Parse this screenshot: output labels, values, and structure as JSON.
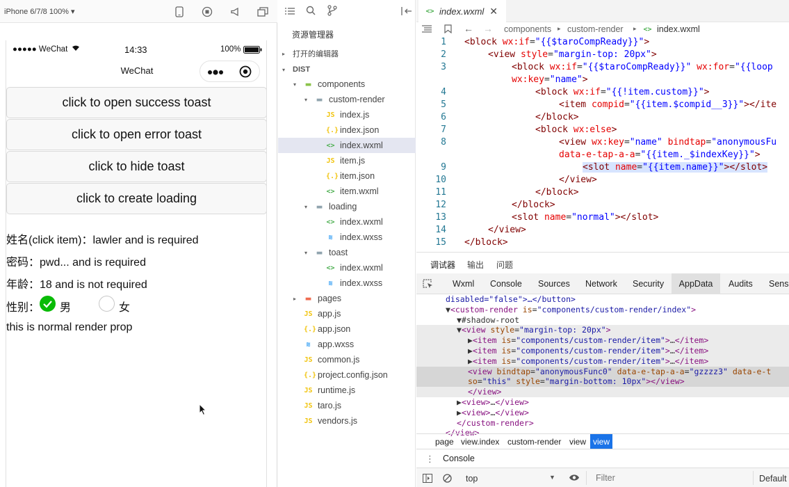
{
  "simulator": {
    "device": "iPhone 6/7/8 100% ▾",
    "status": {
      "carrier": "●●●●● WeChat",
      "time": "14:33",
      "battery": "100%"
    },
    "nav_title": "WeChat",
    "buttons": [
      "click to open success toast",
      "click to open error toast",
      "click to hide toast",
      "click to create loading"
    ],
    "lines": {
      "name": "姓名(click item)：lawler and is required",
      "password": "密码：pwd... and is required",
      "age": "年龄：18 and is not required",
      "gender_label": "性别：",
      "male": "男",
      "female": "女",
      "normal": "this is normal render prop"
    }
  },
  "explorer": {
    "title": "资源管理器",
    "open_editors": "打开的编辑器",
    "root": "DIST",
    "items": [
      {
        "label": "components",
        "icon": "folder-icon",
        "color": "#8bc34a",
        "depth": 1,
        "caret": "▾"
      },
      {
        "label": "custom-render",
        "icon": "folder-icon",
        "color": "#90a4ae",
        "depth": 2,
        "caret": "▾"
      },
      {
        "label": "index.js",
        "icon": "js-file-icon",
        "color": "#f1c40f",
        "depth": 3,
        "caret": ""
      },
      {
        "label": "index.json",
        "icon": "json-file-icon",
        "color": "#f1c40f",
        "depth": 3,
        "caret": ""
      },
      {
        "label": "index.wxml",
        "icon": "wxml-file-icon",
        "color": "#4caf50",
        "depth": 3,
        "caret": "",
        "selected": true
      },
      {
        "label": "item.js",
        "icon": "js-file-icon",
        "color": "#f1c40f",
        "depth": 3,
        "caret": ""
      },
      {
        "label": "item.json",
        "icon": "json-file-icon",
        "color": "#f1c40f",
        "depth": 3,
        "caret": ""
      },
      {
        "label": "item.wxml",
        "icon": "wxml-file-icon",
        "color": "#4caf50",
        "depth": 3,
        "caret": ""
      },
      {
        "label": "loading",
        "icon": "folder-icon",
        "color": "#90a4ae",
        "depth": 2,
        "caret": "▾"
      },
      {
        "label": "index.wxml",
        "icon": "wxml-file-icon",
        "color": "#4caf50",
        "depth": 3,
        "caret": ""
      },
      {
        "label": "index.wxss",
        "icon": "wxss-file-icon",
        "color": "#2196f3",
        "depth": 3,
        "caret": ""
      },
      {
        "label": "toast",
        "icon": "folder-icon",
        "color": "#90a4ae",
        "depth": 2,
        "caret": "▾"
      },
      {
        "label": "index.wxml",
        "icon": "wxml-file-icon",
        "color": "#4caf50",
        "depth": 3,
        "caret": ""
      },
      {
        "label": "index.wxss",
        "icon": "wxss-file-icon",
        "color": "#2196f3",
        "depth": 3,
        "caret": ""
      },
      {
        "label": "pages",
        "icon": "folder-icon",
        "color": "#ef6c50",
        "depth": 1,
        "caret": "▸"
      },
      {
        "label": "app.js",
        "icon": "js-file-icon",
        "color": "#f1c40f",
        "depth": 1,
        "caret": ""
      },
      {
        "label": "app.json",
        "icon": "json-file-icon",
        "color": "#f1c40f",
        "depth": 1,
        "caret": ""
      },
      {
        "label": "app.wxss",
        "icon": "wxss-file-icon",
        "color": "#2196f3",
        "depth": 1,
        "caret": ""
      },
      {
        "label": "common.js",
        "icon": "js-file-icon",
        "color": "#f1c40f",
        "depth": 1,
        "caret": ""
      },
      {
        "label": "project.config.json",
        "icon": "json-file-icon",
        "color": "#f1c40f",
        "depth": 1,
        "caret": ""
      },
      {
        "label": "runtime.js",
        "icon": "js-file-icon",
        "color": "#f1c40f",
        "depth": 1,
        "caret": ""
      },
      {
        "label": "taro.js",
        "icon": "js-file-icon",
        "color": "#f1c40f",
        "depth": 1,
        "caret": ""
      },
      {
        "label": "vendors.js",
        "icon": "js-file-icon",
        "color": "#f1c40f",
        "depth": 1,
        "caret": ""
      }
    ]
  },
  "editor": {
    "tab": "index.wxml",
    "breadcrumb": [
      "components",
      "custom-render",
      "index.wxml"
    ],
    "lines": [
      {
        "n": "1",
        "indent": 0,
        "tokens": [
          [
            "tg",
            "<block "
          ],
          [
            "at",
            "wx:if"
          ],
          [
            "pl",
            "="
          ],
          [
            "st",
            "\"{{$taroCompReady}}\""
          ],
          [
            "tg",
            ">"
          ]
        ]
      },
      {
        "n": "2",
        "indent": 1,
        "tokens": [
          [
            "tg",
            "<view "
          ],
          [
            "at",
            "style"
          ],
          [
            "pl",
            "="
          ],
          [
            "st",
            "\"margin-top: 20px\""
          ],
          [
            "tg",
            ">"
          ]
        ]
      },
      {
        "n": "3",
        "indent": 2,
        "tokens": [
          [
            "tg",
            "<block "
          ],
          [
            "at",
            "wx:if"
          ],
          [
            "pl",
            "="
          ],
          [
            "st",
            "\"{{$taroCompReady}}\""
          ],
          [
            "pl",
            " "
          ],
          [
            "at",
            "wx:for"
          ],
          [
            "pl",
            "="
          ],
          [
            "st",
            "\"{{loop"
          ]
        ]
      },
      {
        "n": "",
        "indent": 2,
        "tokens": [
          [
            "at",
            "wx:key"
          ],
          [
            "pl",
            "="
          ],
          [
            "st",
            "\"name\""
          ],
          [
            "tg",
            ">"
          ]
        ]
      },
      {
        "n": "4",
        "indent": 3,
        "tokens": [
          [
            "tg",
            "<block "
          ],
          [
            "at",
            "wx:if"
          ],
          [
            "pl",
            "="
          ],
          [
            "st",
            "\"{{!item.custom}}\""
          ],
          [
            "tg",
            ">"
          ]
        ]
      },
      {
        "n": "5",
        "indent": 4,
        "tokens": [
          [
            "tg",
            "<item "
          ],
          [
            "at",
            "compid"
          ],
          [
            "pl",
            "="
          ],
          [
            "st",
            "\"{{item.$compid__3}}\""
          ],
          [
            "tg",
            "></ite"
          ]
        ]
      },
      {
        "n": "6",
        "indent": 3,
        "tokens": [
          [
            "tg",
            "</block>"
          ]
        ]
      },
      {
        "n": "7",
        "indent": 3,
        "tokens": [
          [
            "tg",
            "<block "
          ],
          [
            "at",
            "wx:else"
          ],
          [
            "tg",
            ">"
          ]
        ]
      },
      {
        "n": "8",
        "indent": 4,
        "tokens": [
          [
            "tg",
            "<view "
          ],
          [
            "at",
            "wx:key"
          ],
          [
            "pl",
            "="
          ],
          [
            "st",
            "\"name\""
          ],
          [
            "pl",
            " "
          ],
          [
            "at",
            "bindtap"
          ],
          [
            "pl",
            "="
          ],
          [
            "st",
            "\"anonymousFu"
          ]
        ]
      },
      {
        "n": "",
        "indent": 4,
        "tokens": [
          [
            "at",
            "data-e-tap-a-a"
          ],
          [
            "pl",
            "="
          ],
          [
            "st",
            "\"{{item._$indexKey}}\""
          ],
          [
            "tg",
            ">"
          ]
        ]
      },
      {
        "n": "9",
        "indent": 5,
        "hl": true,
        "tokens": [
          [
            "tg",
            "<slot "
          ],
          [
            "at",
            "name"
          ],
          [
            "pl",
            "="
          ],
          [
            "st",
            "\"{{item.name}}\""
          ],
          [
            "tg",
            "></slot>"
          ]
        ]
      },
      {
        "n": "10",
        "indent": 4,
        "tokens": [
          [
            "tg",
            "</view>"
          ]
        ]
      },
      {
        "n": "11",
        "indent": 3,
        "tokens": [
          [
            "tg",
            "</block>"
          ]
        ]
      },
      {
        "n": "12",
        "indent": 2,
        "tokens": [
          [
            "tg",
            "</block>"
          ]
        ]
      },
      {
        "n": "13",
        "indent": 2,
        "tokens": [
          [
            "tg",
            "<slot "
          ],
          [
            "at",
            "name"
          ],
          [
            "pl",
            "="
          ],
          [
            "st",
            "\"normal\""
          ],
          [
            "tg",
            "></slot>"
          ]
        ]
      },
      {
        "n": "14",
        "indent": 1,
        "tokens": [
          [
            "tg",
            "</view>"
          ]
        ]
      },
      {
        "n": "15",
        "indent": 0,
        "tokens": [
          [
            "tg",
            "</block>"
          ]
        ]
      }
    ]
  },
  "devtools": {
    "top_tabs": [
      "调试器",
      "输出",
      "问题"
    ],
    "panel_tabs": [
      "Wxml",
      "Console",
      "Sources",
      "Network",
      "Security",
      "AppData",
      "Audits",
      "Sensor"
    ],
    "dom": [
      {
        "indent": 0,
        "cls": "",
        "tokens": [
          [
            "dv",
            "disabled=\"false\">…</button>"
          ]
        ]
      },
      {
        "indent": 0,
        "cls": "",
        "tokens": [
          [
            "pl",
            "▼"
          ],
          [
            "dt",
            "<custom-render "
          ],
          [
            "da",
            "is"
          ],
          [
            "pl",
            "="
          ],
          [
            "dv",
            "\"components/custom-render/index\""
          ],
          [
            "dt",
            ">"
          ]
        ]
      },
      {
        "indent": 1,
        "cls": "",
        "tokens": [
          [
            "pl",
            "▼#shadow-root"
          ]
        ]
      },
      {
        "indent": 1,
        "cls": "shade",
        "tokens": [
          [
            "pl",
            "▼"
          ],
          [
            "dt",
            "<view "
          ],
          [
            "da",
            "style"
          ],
          [
            "pl",
            "="
          ],
          [
            "dv",
            "\"margin-top: 20px\""
          ],
          [
            "dt",
            ">"
          ]
        ]
      },
      {
        "indent": 2,
        "cls": "shade",
        "tokens": [
          [
            "pl",
            "▶"
          ],
          [
            "dt",
            "<item "
          ],
          [
            "da",
            "is"
          ],
          [
            "pl",
            "="
          ],
          [
            "dv",
            "\"components/custom-render/item\""
          ],
          [
            "dt",
            ">"
          ],
          [
            "pl",
            "…"
          ],
          [
            "dt",
            "</item>"
          ]
        ]
      },
      {
        "indent": 2,
        "cls": "shade",
        "tokens": [
          [
            "pl",
            "▶"
          ],
          [
            "dt",
            "<item "
          ],
          [
            "da",
            "is"
          ],
          [
            "pl",
            "="
          ],
          [
            "dv",
            "\"components/custom-render/item\""
          ],
          [
            "dt",
            ">"
          ],
          [
            "pl",
            "…"
          ],
          [
            "dt",
            "</item>"
          ]
        ]
      },
      {
        "indent": 2,
        "cls": "shade",
        "tokens": [
          [
            "pl",
            "▶"
          ],
          [
            "dt",
            "<item "
          ],
          [
            "da",
            "is"
          ],
          [
            "pl",
            "="
          ],
          [
            "dv",
            "\"components/custom-render/item\""
          ],
          [
            "dt",
            ">"
          ],
          [
            "pl",
            "…"
          ],
          [
            "dt",
            "</item>"
          ]
        ]
      },
      {
        "indent": 2,
        "cls": "sel",
        "tokens": [
          [
            "dt",
            "<view "
          ],
          [
            "da",
            "bindtap"
          ],
          [
            "pl",
            "="
          ],
          [
            "dv",
            "\"anonymousFunc0\""
          ],
          [
            "pl",
            " "
          ],
          [
            "da",
            "data-e-tap-a-a"
          ],
          [
            "pl",
            "="
          ],
          [
            "dv",
            "\"gzzzz3\""
          ],
          [
            "pl",
            " "
          ],
          [
            "da",
            "data-e-t"
          ]
        ]
      },
      {
        "indent": 2,
        "cls": "sel",
        "tokens": [
          [
            "da",
            "so"
          ],
          [
            "pl",
            "="
          ],
          [
            "dv",
            "\"this\""
          ],
          [
            "pl",
            " "
          ],
          [
            "da",
            "style"
          ],
          [
            "pl",
            "="
          ],
          [
            "dv",
            "\"margin-bottom: 10px\""
          ],
          [
            "dt",
            "></view>"
          ]
        ]
      },
      {
        "indent": 2,
        "cls": "shade",
        "tokens": [
          [
            "dt",
            "</view>"
          ]
        ]
      },
      {
        "indent": 1,
        "cls": "",
        "tokens": [
          [
            "pl",
            "▶"
          ],
          [
            "dt",
            "<view>"
          ],
          [
            "pl",
            "…"
          ],
          [
            "dt",
            "</view>"
          ]
        ]
      },
      {
        "indent": 1,
        "cls": "",
        "tokens": [
          [
            "pl",
            "▶"
          ],
          [
            "dt",
            "<view>"
          ],
          [
            "pl",
            "…"
          ],
          [
            "dt",
            "</view>"
          ]
        ]
      },
      {
        "indent": 1,
        "cls": "",
        "tokens": [
          [
            "dt",
            "</custom-render>"
          ]
        ]
      },
      {
        "indent": 0,
        "cls": "",
        "tokens": [
          [
            "dt",
            "</view>"
          ]
        ]
      }
    ],
    "dom_breadcrumb": [
      "page",
      "view.index",
      "custom-render",
      "view",
      "view"
    ],
    "console_label": "Console",
    "context": "top",
    "filter_placeholder": "Filter",
    "levels": "Default"
  }
}
